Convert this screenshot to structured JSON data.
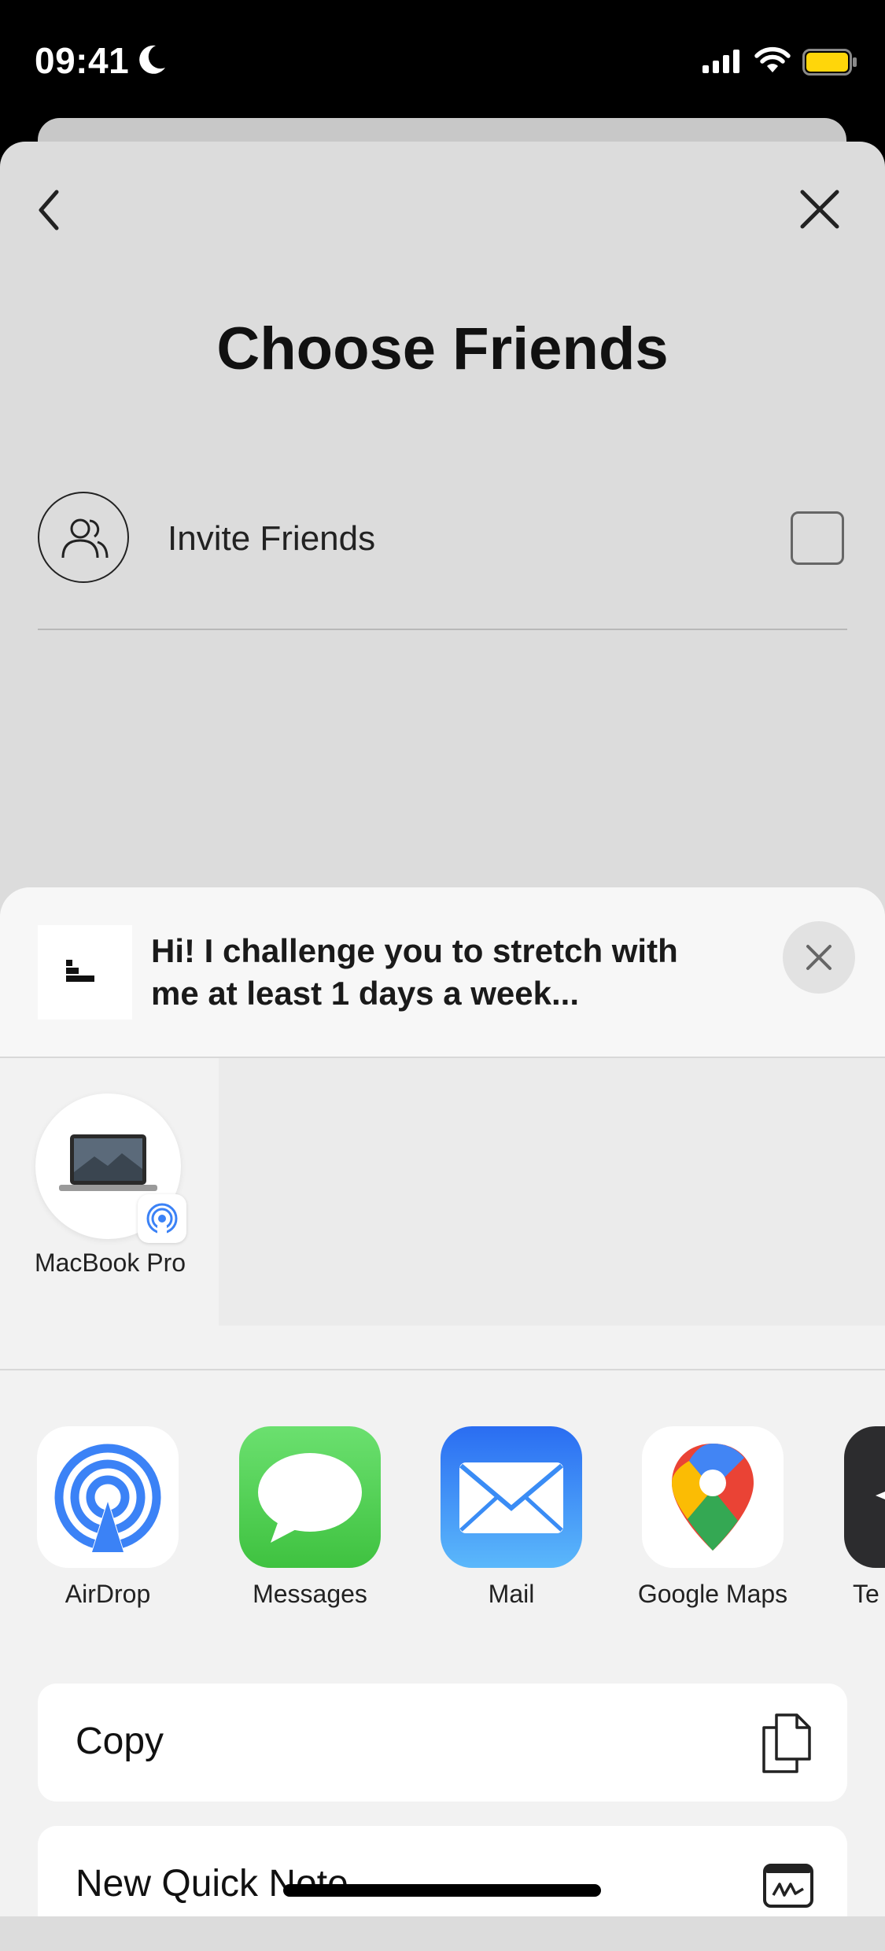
{
  "status_bar": {
    "time": "09:41"
  },
  "page": {
    "title": "Choose Friends"
  },
  "invite": {
    "label": "Invite Friends"
  },
  "share": {
    "message": "Hi! I challenge you to stretch with me at least 1 days a week...",
    "device_name": "MacBook Pro",
    "apps": [
      {
        "label": "AirDrop",
        "icon": "airdrop-icon"
      },
      {
        "label": "Messages",
        "icon": "messages-icon"
      },
      {
        "label": "Mail",
        "icon": "mail-icon"
      },
      {
        "label": "Google Maps",
        "icon": "google-maps-icon"
      },
      {
        "label": "Te",
        "icon": "telegram-icon"
      }
    ],
    "actions": [
      {
        "label": "Copy",
        "icon": "copy-icon"
      },
      {
        "label": "New Quick Note",
        "icon": "quick-note-icon"
      }
    ]
  },
  "colors": {
    "sheet_background": "#dcdcdc",
    "share_background": "#f2f2f2",
    "airdrop_blue": "#3b82f6",
    "messages_green": "#4cd964",
    "mail_blue": "#2f7df6",
    "battery_yellow": "#ffd60a"
  }
}
